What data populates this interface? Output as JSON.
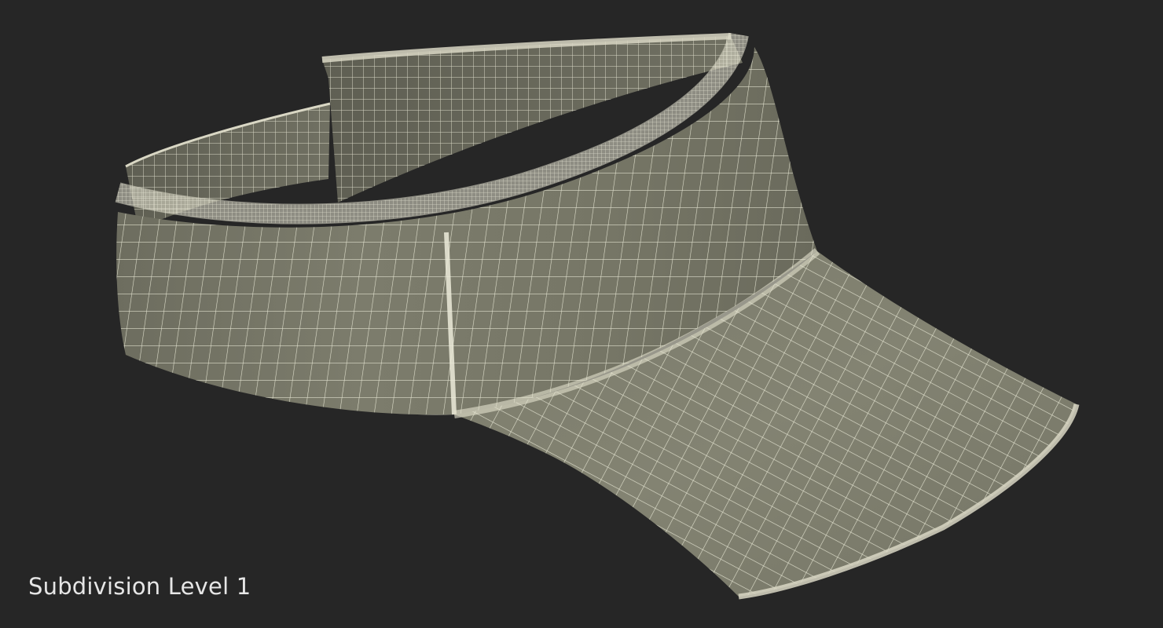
{
  "caption": {
    "text": "Subdivision Level 1"
  },
  "scene": {
    "background_color": "#262626",
    "surface_color": "#7a7a6a",
    "wire_color": "#ecebd9",
    "edge_color": "#d9d7c4"
  }
}
